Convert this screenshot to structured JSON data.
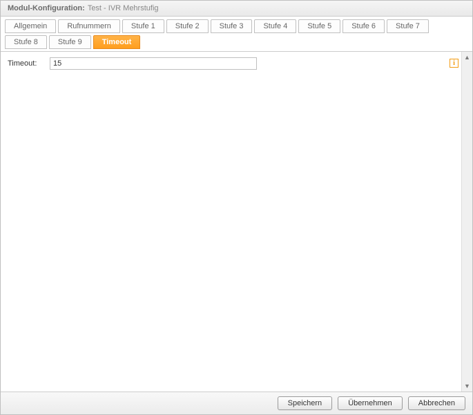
{
  "header": {
    "title_label": "Modul-Konfiguration:",
    "title_name": "Test - IVR Mehrstufig"
  },
  "tabs": [
    {
      "label": "Allgemein",
      "active": false
    },
    {
      "label": "Rufnummern",
      "active": false
    },
    {
      "label": "Stufe 1",
      "active": false
    },
    {
      "label": "Stufe 2",
      "active": false
    },
    {
      "label": "Stufe 3",
      "active": false
    },
    {
      "label": "Stufe 4",
      "active": false
    },
    {
      "label": "Stufe 5",
      "active": false
    },
    {
      "label": "Stufe 6",
      "active": false
    },
    {
      "label": "Stufe 7",
      "active": false
    },
    {
      "label": "Stufe 8",
      "active": false
    },
    {
      "label": "Stufe 9",
      "active": false
    },
    {
      "label": "Timeout",
      "active": true
    }
  ],
  "form": {
    "timeout_label": "Timeout:",
    "timeout_value": "15"
  },
  "info_icon": {
    "glyph": "i"
  },
  "footer": {
    "save": "Speichern",
    "apply": "Übernehmen",
    "cancel": "Abbrechen"
  },
  "scroll": {
    "up_glyph": "▲",
    "down_glyph": "▼"
  }
}
